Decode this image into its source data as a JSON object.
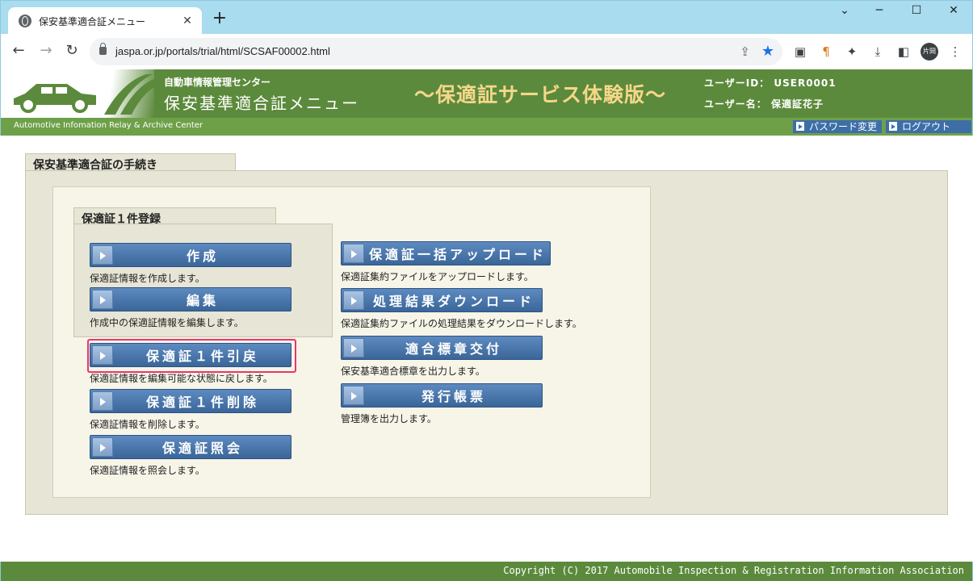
{
  "browser": {
    "tab_title": "保安基準適合証メニュー",
    "tab_close": "✕",
    "new_tab": "+",
    "minimize": "─",
    "maximize": "☐",
    "close": "✕",
    "url": "jaspa.or.jp/portals/trial/html/SCSAF00002.html",
    "profile": "片岡"
  },
  "header": {
    "org_name": "自動車情報管理センター",
    "app_title": "保安基準適合証メニュー",
    "trial_title": "～保適証サービス体験版～",
    "user_id_line": "ユーザーID： USER0001",
    "user_name_line": "ユーザー名： 保適証花子",
    "english_name": "Automotive Infomation Relay & Archive Center",
    "password_btn": "パスワード変更",
    "logout_btn": "ログアウト"
  },
  "main": {
    "section_title": "保安基準適合証の手続き",
    "group_title": "保適証１件登録",
    "left_buttons": [
      {
        "label": "作成",
        "desc": "保適証情報を作成します。"
      },
      {
        "label": "編集",
        "desc": "作成中の保適証情報を編集します。"
      },
      {
        "label": "保適証１件引戻",
        "desc": "保適証情報を編集可能な状態に戻します。"
      },
      {
        "label": "保適証１件削除",
        "desc": "保適証情報を削除します。"
      },
      {
        "label": "保適証照会",
        "desc": "保適証情報を照会します。"
      }
    ],
    "right_buttons": [
      {
        "label": "保適証一括アップロード",
        "desc": "保適証集約ファイルをアップロードします。"
      },
      {
        "label": "処理結果ダウンロード",
        "desc": "保適証集約ファイルの処理結果をダウンロードします。"
      },
      {
        "label": "適合標章交付",
        "desc": "保安基準適合標章を出力します。"
      },
      {
        "label": "発行帳票",
        "desc": "管理簿を出力します。"
      }
    ]
  },
  "footer": {
    "copyright": "Copyright (C) 2017 Automobile Inspection & Registration Information Association"
  },
  "colors": {
    "header_green": "#5c8a3c",
    "trial_title": "#f5d78a",
    "button_blue": "#3a6699",
    "highlight": "#e8356e",
    "panel": "#e7e5d6"
  }
}
